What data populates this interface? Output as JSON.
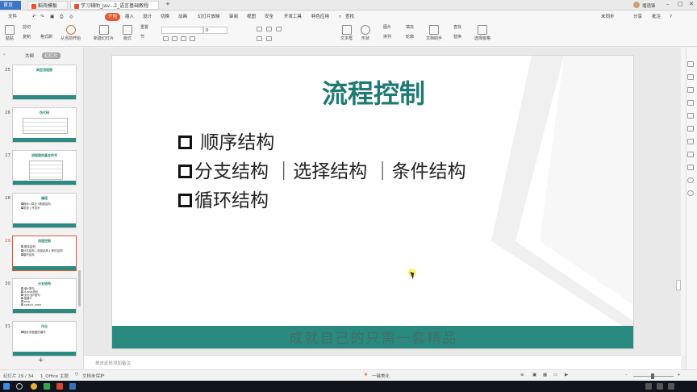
{
  "tabs": [
    {
      "label": "首页"
    },
    {
      "label": "稻壳模板"
    },
    {
      "label": "学习辅助_Jav...2_语言基础教程"
    }
  ],
  "menu": [
    "文件",
    "开始",
    "插入",
    "设计",
    "切换",
    "动画",
    "幻灯片放映",
    "审阅",
    "视图",
    "安全",
    "开发工具",
    "特色应用",
    "查找"
  ],
  "menu_right": [
    "未同步",
    "分享",
    "批注"
  ],
  "ribbon": {
    "paste": "粘贴",
    "cut": "剪切",
    "copy": "复制",
    "format_painter": "格式刷",
    "from_current": "从当前开始",
    "new_slide": "新建幻灯片",
    "layout": "版式",
    "section": "节",
    "reset": "重置",
    "font_size": "0",
    "textbox": "文本框",
    "shape": "形状",
    "arrange": "排列",
    "picture": "图片",
    "fill": "填充",
    "outline": "轮廓",
    "find": "查找",
    "replace": "替换",
    "text_tools": "文档助手",
    "select_pane": "选择窗格"
  },
  "sidepanel": {
    "outline_tab": "大纲",
    "slides_tab": "幻灯片",
    "thumbs": [
      {
        "num": "25",
        "title": "典型流程图",
        "lines": []
      },
      {
        "num": "26",
        "title": "伪代码",
        "lines": []
      },
      {
        "num": "27",
        "title": "流程图的基本符号",
        "lines": []
      },
      {
        "num": "28",
        "title": "编程",
        "lines": [
          "◘程序=算法+数据结构",
          "◘发现 | 开发步"
        ]
      },
      {
        "num": "29",
        "title": "流程控制",
        "lines": [
          "◘ 顺序结构",
          "◘分支结构 | 选择结构 | 条件结构",
          "◘循环结构"
        ]
      },
      {
        "num": "30",
        "title": "分支结构",
        "lines": [
          "◘ 单if语句",
          "◘ if-else语句",
          "◘ 多分支if语句",
          "◘ 嵌套if",
          "◘    else",
          "◘ switch_case"
        ]
      },
      {
        "num": "31",
        "title": "作业",
        "lines": [
          "◘程序流程图的编写"
        ]
      }
    ],
    "add": "+"
  },
  "slide": {
    "title": "流程控制",
    "bullets": [
      "顺序结构",
      "分支结构 ｜选择结构 ｜条件结构",
      "循环结构"
    ],
    "footer": "成就自己的只需一套精品"
  },
  "notes_placeholder": "单击此处添加备注",
  "status": {
    "slide_count": "幻灯片 29 / 34",
    "theme": "1_Office 主题",
    "backup": "文档未保护",
    "beautify": "一键美化",
    "zoom": "+"
  },
  "user": "堰语锋",
  "colors": {
    "accent": "#e8542c",
    "teal": "#2a8a80",
    "title": "#1f7a74"
  }
}
